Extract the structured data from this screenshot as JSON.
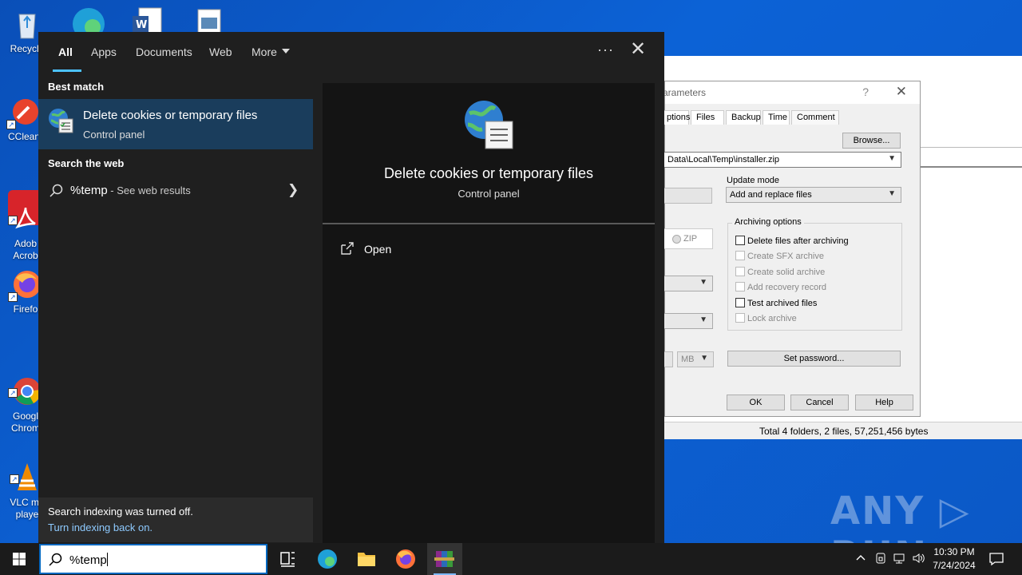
{
  "desktop": {
    "icons": [
      {
        "label": "Recycle"
      },
      {
        "label": "CClean"
      },
      {
        "label": "Adob\nAcrob"
      },
      {
        "label": "Firefo"
      },
      {
        "label": "Googl\nChrom"
      },
      {
        "label": "VLC me\nplaye"
      }
    ]
  },
  "background_app": {
    "dialog_title": "arameters",
    "help_glyph": "?",
    "close_glyph": "✕",
    "tabs": [
      "ptions",
      "Files",
      "Backup",
      "Time",
      "Comment"
    ],
    "browse_button": "Browse...",
    "archive_path": "Data\\Local\\Temp\\installer.zip",
    "update_mode_label": "Update mode",
    "update_mode_value": "Add and replace files",
    "zip_label": "ZIP",
    "archiving_options_title": "Archiving options",
    "options": [
      {
        "label": "Delete files after archiving",
        "enabled": true
      },
      {
        "label": "Create SFX archive",
        "enabled": false
      },
      {
        "label": "Create solid archive",
        "enabled": false
      },
      {
        "label": "Add recovery record",
        "enabled": false
      },
      {
        "label": "Test archived files",
        "enabled": true
      },
      {
        "label": "Lock archive",
        "enabled": false
      }
    ],
    "unit_value": "MB",
    "set_password_button": "Set password...",
    "ok_button": "OK",
    "cancel_button": "Cancel",
    "help_button": "Help",
    "status_text": "Total 4 folders, 2 files, 57,251,456 bytes"
  },
  "watermark": "ANY RUN",
  "search_panel": {
    "tabs": [
      {
        "label": "All",
        "active": true
      },
      {
        "label": "Apps"
      },
      {
        "label": "Documents"
      },
      {
        "label": "Web"
      },
      {
        "label": "More"
      }
    ],
    "more_options_glyph": "···",
    "close_glyph": "✕",
    "best_match_header": "Best match",
    "best_match": {
      "title": "Delete cookies or temporary files",
      "subtitle": "Control panel"
    },
    "web_header": "Search the web",
    "web_result": {
      "query": "%temp",
      "suffix": " - See web results"
    },
    "indexing_notice": "Search indexing was turned off.",
    "indexing_link": "Turn indexing back on.",
    "preview": {
      "title": "Delete cookies or temporary files",
      "subtitle": "Control panel",
      "open_label": "Open"
    }
  },
  "taskbar": {
    "search_value": "%temp",
    "clock_time": "10:30 PM",
    "clock_date": "7/24/2024"
  },
  "colors": {
    "accent": "#4cc2ff",
    "selected_item": "#1a3d5c",
    "panel_bg": "#1f1f1f",
    "desktop_bg": "#0c62d6",
    "link": "#8ecaff"
  }
}
